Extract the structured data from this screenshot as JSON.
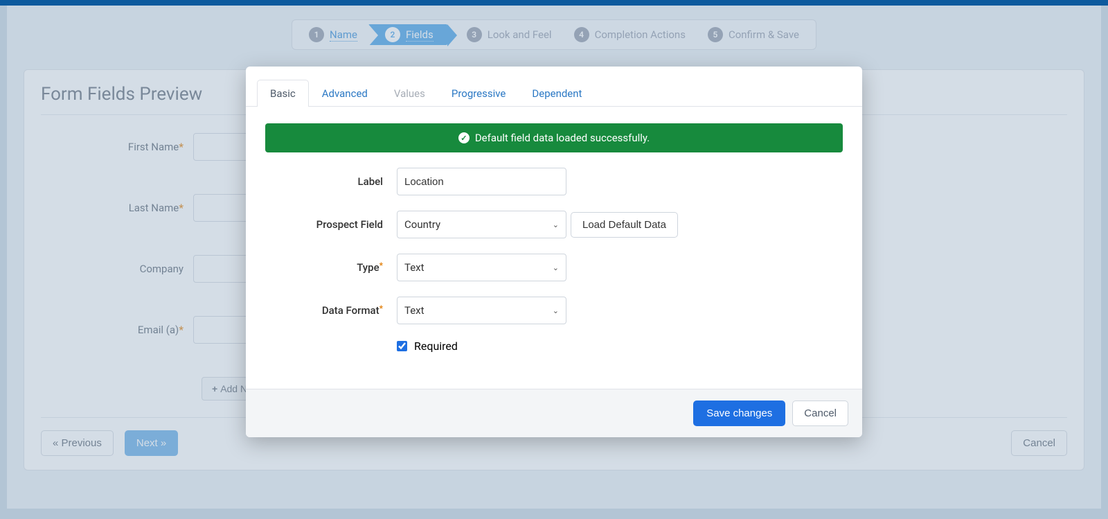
{
  "wizard": {
    "steps": [
      {
        "num": "1",
        "label": "Name"
      },
      {
        "num": "2",
        "label": "Fields"
      },
      {
        "num": "3",
        "label": "Look and Feel"
      },
      {
        "num": "4",
        "label": "Completion Actions"
      },
      {
        "num": "5",
        "label": "Confirm & Save"
      }
    ]
  },
  "panel": {
    "title": "Form Fields Preview",
    "fields": [
      {
        "label": "First Name",
        "required": true
      },
      {
        "label": "Last Name",
        "required": true
      },
      {
        "label": "Company",
        "required": false
      },
      {
        "label": "Email (a)",
        "required": true
      }
    ],
    "add_label": "Add New",
    "prev_label": "« Previous",
    "next_label": "Next »",
    "cancel_label": "Cancel"
  },
  "modal": {
    "tabs": {
      "basic": "Basic",
      "advanced": "Advanced",
      "values": "Values",
      "progressive": "Progressive",
      "dependent": "Dependent"
    },
    "alert": "Default field data loaded successfully.",
    "form": {
      "label_label": "Label",
      "label_value": "Location",
      "prospect_label": "Prospect Field",
      "prospect_value": "Country",
      "load_default_label": "Load Default Data",
      "type_label": "Type",
      "type_value": "Text",
      "format_label": "Data Format",
      "format_value": "Text",
      "required_label": "Required",
      "required_checked": true
    },
    "save_label": "Save changes",
    "cancel_label": "Cancel"
  }
}
